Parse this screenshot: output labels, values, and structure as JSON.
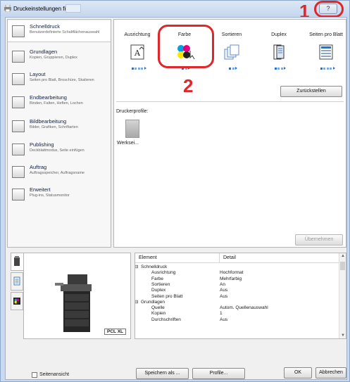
{
  "window": {
    "title": "Druckeinstellungen für",
    "help_label": "?"
  },
  "callouts": {
    "one": "1",
    "two": "2"
  },
  "sidebar": {
    "items": [
      {
        "title": "Schnelldruck",
        "subtitle": "Benutzerdefinierte Schaltflächenauswahl",
        "icon": "quick-print-icon"
      },
      {
        "title": "Grundlagen",
        "subtitle": "Kopien, Gruppieren, Duplex",
        "icon": "basic-icon"
      },
      {
        "title": "Layout",
        "subtitle": "Seiten pro Blatt, Broschüre, Skalieren",
        "icon": "layout-icon"
      },
      {
        "title": "Endbearbeitung",
        "subtitle": "Binden, Falten, Heften, Lochen",
        "icon": "finishing-icon"
      },
      {
        "title": "Bildbearbeitung",
        "subtitle": "Bilder, Grafiken, Schriftarten",
        "icon": "imaging-icon"
      },
      {
        "title": "Publishing",
        "subtitle": "Deckblattmodus, Seite einfügen",
        "icon": "publishing-icon"
      },
      {
        "title": "Auftrag",
        "subtitle": "Auftragsspeicher, Auftragsname",
        "icon": "job-icon"
      },
      {
        "title": "Erweitert",
        "subtitle": "Plug-ins, Statusmonitor",
        "icon": "advanced-icon"
      }
    ]
  },
  "quickprint": {
    "columns": [
      {
        "label": "Ausrichtung",
        "icon": "orientation-icon"
      },
      {
        "label": "Farbe",
        "icon": "color-icon"
      },
      {
        "label": "Sortieren",
        "icon": "collate-icon"
      },
      {
        "label": "Duplex",
        "icon": "duplex-icon"
      },
      {
        "label": "Seiten pro Blatt",
        "icon": "pages-per-sheet-icon"
      }
    ],
    "reset_label": "Zurückstellen",
    "profiles_label": "Druckerprofile:",
    "profile_name": "Werksei...",
    "apply_label": "Übernehmen"
  },
  "preview": {
    "badge": "PCL XL"
  },
  "settings_table": {
    "col_element": "Element",
    "col_detail": "Detail",
    "rows": [
      {
        "element": "Schnelldruck",
        "detail": "",
        "group": true
      },
      {
        "element": "Ausrichtung",
        "detail": "Hochformat",
        "group": false
      },
      {
        "element": "Farbe",
        "detail": "Mehrfarbig",
        "group": false
      },
      {
        "element": "Sortieren",
        "detail": "An",
        "group": false
      },
      {
        "element": "Duplex",
        "detail": "Aus",
        "group": false
      },
      {
        "element": "Seiten pro Blatt",
        "detail": "Aus",
        "group": false
      },
      {
        "element": "Grundlagen",
        "detail": "",
        "group": true
      },
      {
        "element": "Quelle",
        "detail": "Autom. Quellenauswahl",
        "group": false
      },
      {
        "element": "Kopien",
        "detail": "1",
        "group": false
      },
      {
        "element": "Durchschriften",
        "detail": "Aus",
        "group": false
      }
    ]
  },
  "footer": {
    "page_view_label": "Seitenansicht",
    "save_as_label": "Speichern als ...",
    "profile_label": "Profile...",
    "ok_label": "OK",
    "cancel_label": "Abbrechen"
  },
  "colors": {
    "callout": "#e0262b",
    "accent": "#1f6fd1"
  }
}
